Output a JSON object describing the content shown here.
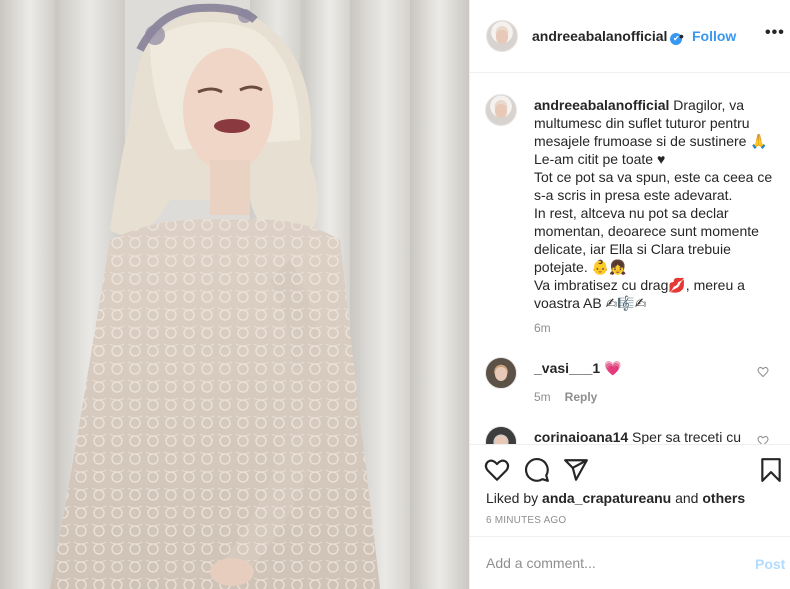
{
  "post": {
    "username": "andreeabalanofficial",
    "verified_mark": "✔",
    "dot": "•",
    "follow_label": "Follow",
    "more_label": "•••",
    "photo_alt": "Photo shared by andreeabalanofficial"
  },
  "caption": {
    "username": "andreeabalanofficial",
    "lines": [
      "Dragilor, va multumesc din suflet tuturor pentru mesajele frumoase si de sustinere 🙏",
      "Le-am citit pe toate ♥",
      "Tot ce pot sa va spun, este ca ceea ce s-a scris in presa este adevarat.",
      "In rest, altceva nu pot sa declar momentan, deoarece sunt momente delicate, iar Ella si Clara trebuie potejate. 👶👧",
      "Va imbratisez cu drag💋, mereu a voastra AB ✍🎼✍"
    ],
    "time": "6m"
  },
  "comments": [
    {
      "username": "_vasi___1",
      "text": "💗",
      "time": "5m",
      "reply_label": "Reply"
    },
    {
      "username": "corinaioana14",
      "text": "Sper sa treceti cu"
    }
  ],
  "actions": {
    "liked_by_prefix": "Liked by",
    "liked_by_user": "anda_crapatureanu",
    "liked_by_suffix": "and",
    "liked_by_others": "others",
    "date": "6 MINUTES AGO"
  },
  "add_comment": {
    "placeholder": "Add a comment...",
    "post_label": "Post"
  },
  "colors": {
    "link_blue": "#3897f0",
    "post_disabled": "#b3dbff",
    "muted": "#8e8e8e",
    "border": "#efefef"
  },
  "icons": {
    "heart": "heart-icon",
    "comment": "comment-icon",
    "share": "paper-plane-icon",
    "save": "bookmark-icon",
    "more": "more-options-icon"
  }
}
